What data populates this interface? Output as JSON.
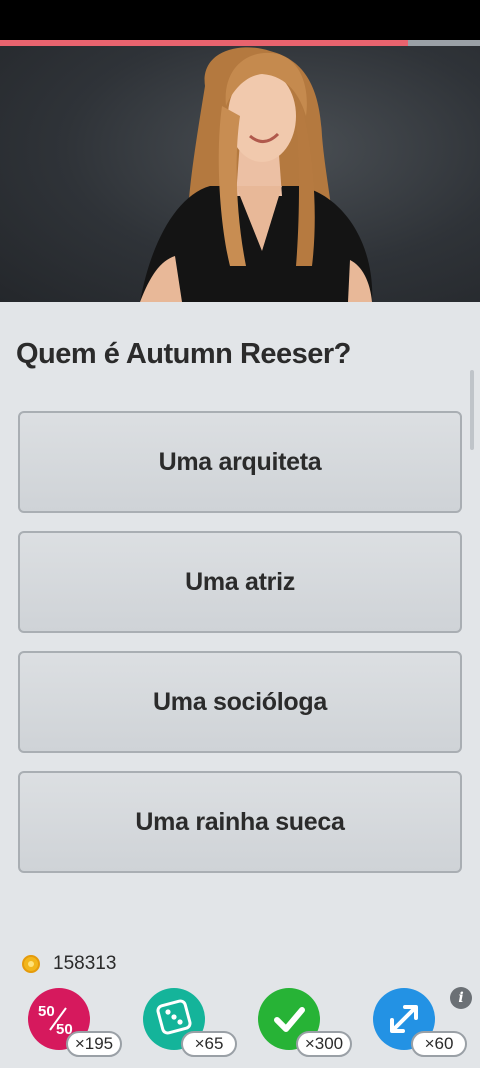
{
  "progress": {
    "fraction": 0.85
  },
  "question": {
    "text": "Quem é Autumn Reeser?"
  },
  "answers": [
    {
      "label": "Uma arquiteta"
    },
    {
      "label": "Uma atriz"
    },
    {
      "label": "Uma socióloga"
    },
    {
      "label": "Uma rainha sueca"
    }
  ],
  "coins": {
    "value": "158313",
    "icon": "coin-icon"
  },
  "powerups": [
    {
      "name": "fifty-fifty",
      "icon": "fifty-fifty-icon",
      "count": "×195",
      "color": "#d6195d"
    },
    {
      "name": "dice",
      "icon": "dice-icon",
      "count": "×65",
      "color": "#14b49a"
    },
    {
      "name": "correct",
      "icon": "check-icon",
      "count": "×300",
      "color": "#27b336"
    },
    {
      "name": "swap",
      "icon": "swap-arrows-icon",
      "count": "×60",
      "color": "#2392e4"
    }
  ],
  "colors": {
    "progress": "#e8636e",
    "background": "#e2e5e8",
    "answer_border": "#a9aeb3"
  }
}
